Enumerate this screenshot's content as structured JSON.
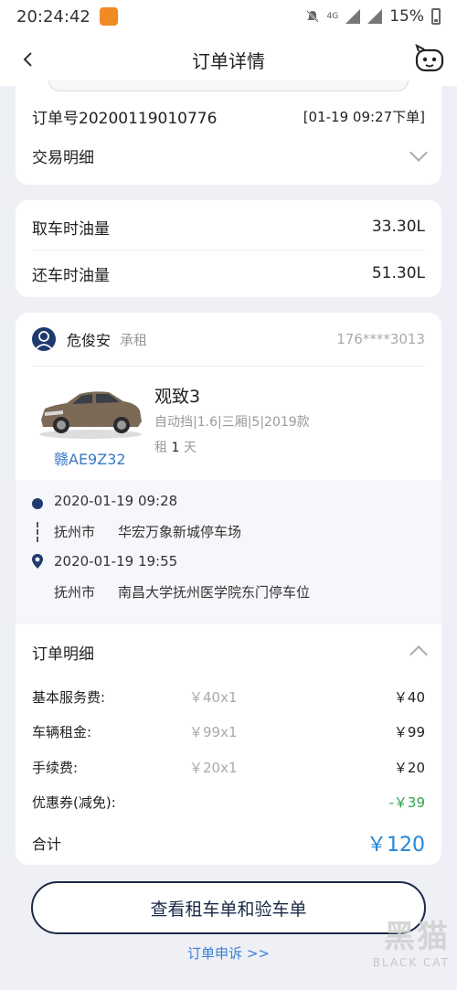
{
  "status_bar": {
    "time": "20:24:42",
    "network": "4G",
    "battery": "15%"
  },
  "header": {
    "title": "订单详情"
  },
  "order": {
    "number": "订单号20200119010776",
    "time": "[01-19 09:27下单]",
    "transaction_label": "交易明细"
  },
  "fuel": {
    "pickup_label": "取车时油量",
    "pickup_value": "33.30L",
    "return_label": "还车时油量",
    "return_value": "51.30L"
  },
  "renter": {
    "name": "危俊安",
    "role": "承租",
    "phone": "176****3013"
  },
  "car": {
    "name": "观致3",
    "spec": "自动挡|1.6|三厢|5|2019款",
    "days_prefix": "租",
    "days": "1",
    "days_suffix": "天",
    "plate": "赣AE9Z32"
  },
  "trip": {
    "start_time": "2020-01-19 09:28",
    "start_city": "抚州市",
    "start_address": "华宏万象新城停车场",
    "end_time": "2020-01-19 19:55",
    "end_city": "抚州市",
    "end_address": "南昌大学抚州医学院东门停车位"
  },
  "details": {
    "title": "订单明细",
    "rows": [
      {
        "label": "基本服务费:",
        "unit": "￥40x1",
        "amount": "￥40"
      },
      {
        "label": "车辆租金:",
        "unit": "￥99x1",
        "amount": "￥99"
      },
      {
        "label": "手续费:",
        "unit": "￥20x1",
        "amount": "￥20"
      },
      {
        "label": "优惠券(减免):",
        "unit": "",
        "amount": "-￥39"
      }
    ],
    "total_label": "合计",
    "total_amount": "￥120"
  },
  "actions": {
    "view_button": "查看租车单和验车单",
    "complaint_link": "订单申诉 >>"
  },
  "watermark": {
    "big": "黑猫",
    "small": "BLACK CAT"
  },
  "colors": {
    "accent_blue": "#2486d8",
    "discount_green": "#2fa24a",
    "navy": "#1c2a47"
  }
}
